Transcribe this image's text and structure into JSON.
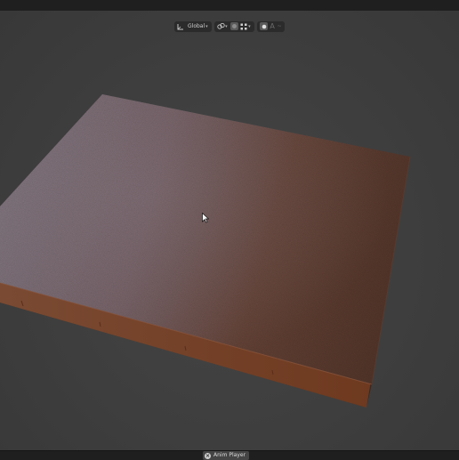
{
  "header": {
    "transform_orientation_label": "Global"
  },
  "viewport": {
    "object": "textured-slab",
    "top_color_left": "#7e7077",
    "top_color_right": "#5e3a2a",
    "side_color": "#6a3a22",
    "background_color": "#3d3d3d"
  },
  "status": {
    "anim_player_label": "Anim Player"
  },
  "icons": {
    "orientation": "transform-orientation-icon",
    "snap": "snap-icon",
    "proportional": "proportional-editing-icon",
    "pivot": "pivot-point-icon",
    "shading": "shading-icon",
    "overlay": "overlay-icon",
    "text": "text-icon",
    "close": "close-icon"
  }
}
